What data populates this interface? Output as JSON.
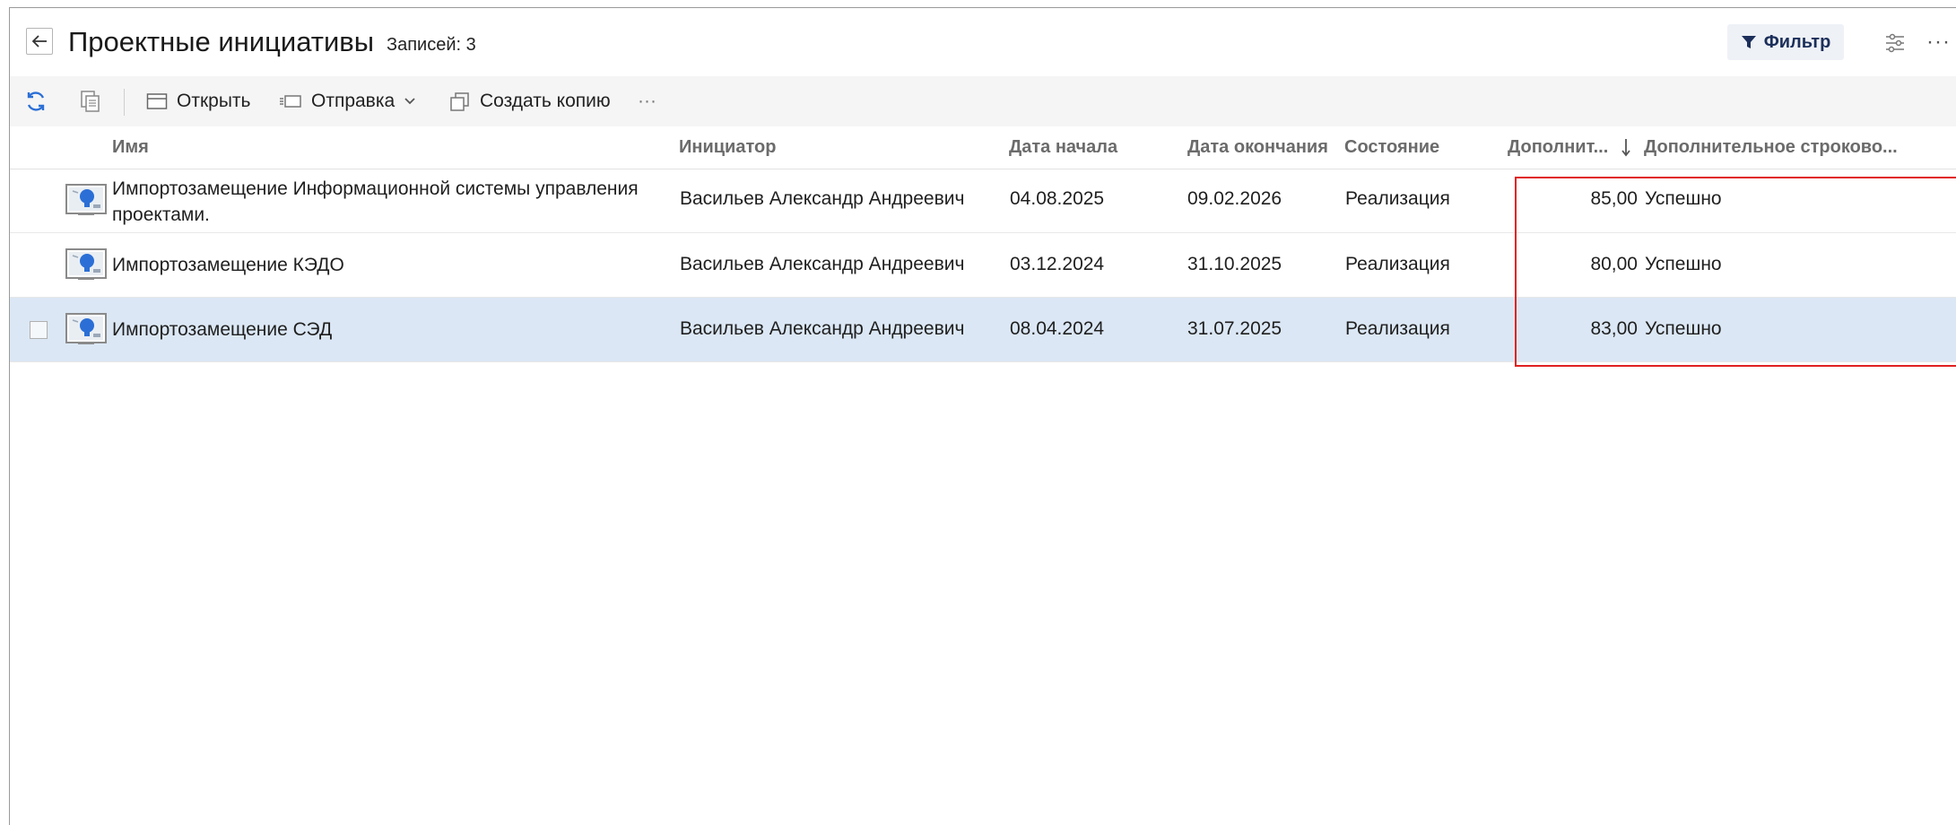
{
  "header": {
    "title": "Проектные инициативы",
    "record_count": "Записей: 3",
    "filter_label": "Фильтр",
    "more_label": "···"
  },
  "toolbar": {
    "open_label": "Открыть",
    "send_label": "Отправка",
    "copy_label": "Создать копию",
    "more_label": "···"
  },
  "columns": [
    "Имя",
    "Инициатор",
    "Дата начала",
    "Дата окончания",
    "Состояние",
    "Дополнит...",
    "Дополнительное строково..."
  ],
  "rows": [
    {
      "name": "Импортозамещение Информационной системы управления проектами.",
      "initiator": "Васильев Александр Андреевич",
      "start": "04.08.2025",
      "end": "09.02.2026",
      "state": "Реализация",
      "extra_num": "85,00",
      "extra_str": "Успешно"
    },
    {
      "name": "Импортозамещение КЭДО",
      "initiator": "Васильев Александр Андреевич",
      "start": "03.12.2024",
      "end": "31.10.2025",
      "state": "Реализация",
      "extra_num": "80,00",
      "extra_str": "Успешно"
    },
    {
      "name": "Импортозамещение СЭД",
      "initiator": "Васильев Александр Андреевич",
      "start": "08.04.2024",
      "end": "31.07.2025",
      "state": "Реализация",
      "extra_num": "83,00",
      "extra_str": "Успешно"
    }
  ],
  "colors": {
    "accent": "#2b6fd6",
    "selected_row": "#dbe7f4",
    "highlight": "#e02020"
  }
}
